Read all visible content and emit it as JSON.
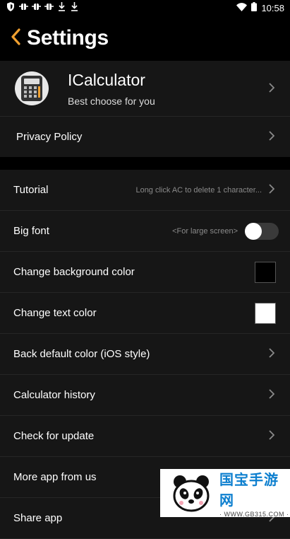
{
  "status_bar": {
    "left_icons": [
      "shield-icon",
      "bug-icon",
      "bug-icon",
      "bug-icon",
      "download-icon",
      "download-icon"
    ],
    "right_icons": [
      "wifi-icon",
      "battery-icon"
    ],
    "time": "10:58"
  },
  "header": {
    "title": "Settings",
    "back_icon": "chevron-left-icon",
    "accent": "#f0a030"
  },
  "app_card": {
    "name": "ICalculator",
    "subtitle": "Best choose for you"
  },
  "privacy": {
    "label": "Privacy Policy"
  },
  "rows": [
    {
      "label": "Tutorial",
      "hint": "Long click AC to delete 1 character...",
      "control": "chevron"
    },
    {
      "label": "Big font",
      "hint": "<For large screen>",
      "control": "toggle",
      "enabled": false
    },
    {
      "label": "Change background color",
      "control": "swatch",
      "color": "#000000"
    },
    {
      "label": "Change text color",
      "control": "swatch",
      "color": "#ffffff"
    },
    {
      "label": "Back default color (iOS style)",
      "control": "chevron"
    },
    {
      "label": "Calculator history",
      "control": "chevron"
    },
    {
      "label": "Check for update",
      "control": "chevron"
    },
    {
      "label": "More app from us",
      "control": "chevron"
    },
    {
      "label": "Share app",
      "control": "chevron"
    }
  ],
  "watermark": {
    "main": "国宝手游网",
    "sub": "· WWW.GB315.COM ·"
  }
}
